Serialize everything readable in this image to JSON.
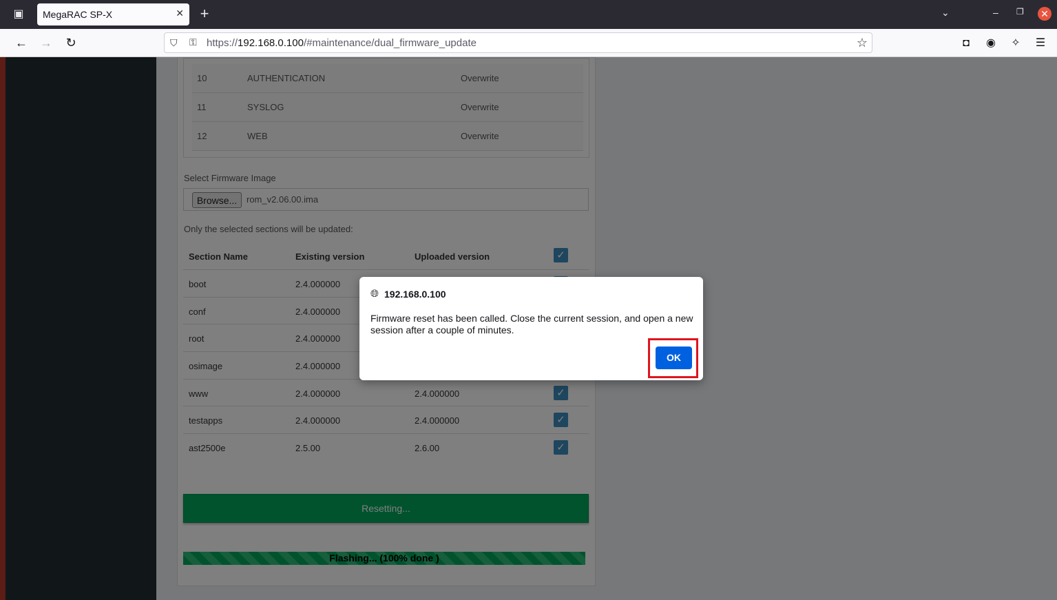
{
  "browser": {
    "tab_title": "MegaRAC SP-X",
    "url_prefix": "https://",
    "url_host": "192.168.0.100",
    "url_path": "/#maintenance/dual_firmware_update"
  },
  "preserve_table": {
    "rows": [
      {
        "num": "10",
        "name": "AUTHENTICATION",
        "action": "Overwrite"
      },
      {
        "num": "11",
        "name": "SYSLOG",
        "action": "Overwrite"
      },
      {
        "num": "12",
        "name": "WEB",
        "action": "Overwrite"
      }
    ]
  },
  "firmware": {
    "select_label": "Select Firmware Image",
    "browse_label": "Browse...",
    "file_name": "rom_v2.06.00.ima",
    "sections_note": "Only the selected sections will be updated:"
  },
  "sections": {
    "headers": {
      "name": "Section Name",
      "existing": "Existing version",
      "uploaded": "Uploaded version"
    },
    "rows": [
      {
        "name": "boot",
        "existing": "2.4.000000",
        "uploaded": "",
        "checked": true
      },
      {
        "name": "conf",
        "existing": "2.4.000000",
        "uploaded": "",
        "checked": true
      },
      {
        "name": "root",
        "existing": "2.4.000000",
        "uploaded": "",
        "checked": true
      },
      {
        "name": "osimage",
        "existing": "2.4.000000",
        "uploaded": "",
        "checked": true
      },
      {
        "name": "www",
        "existing": "2.4.000000",
        "uploaded": "2.4.000000",
        "checked": true
      },
      {
        "name": "testapps",
        "existing": "2.4.000000",
        "uploaded": "2.4.000000",
        "checked": true
      },
      {
        "name": "ast2500e",
        "existing": "2.5.00",
        "uploaded": "2.6.00",
        "checked": true
      }
    ]
  },
  "actions": {
    "reset_label": "Resetting...",
    "progress_text": "Flashing... (100% done )",
    "progress_percent": 100
  },
  "dialog": {
    "host": "192.168.0.100",
    "message": "Firmware reset has been called. Close the current session, and open a new session after a couple of minutes.",
    "ok_label": "OK"
  }
}
